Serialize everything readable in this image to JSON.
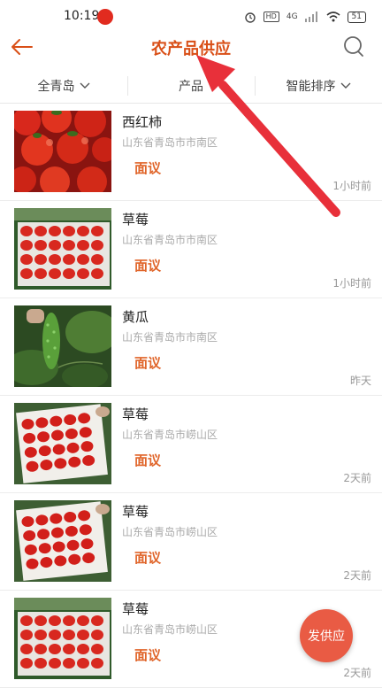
{
  "status_bar": {
    "time": "10:19",
    "hd": "HD",
    "network": "4G",
    "battery": "51"
  },
  "header": {
    "title": "农产品供应",
    "back_icon": "arrow-left-icon",
    "search_icon": "search-icon"
  },
  "filters": [
    {
      "label": "全青岛",
      "has_dropdown": true
    },
    {
      "label": "产品",
      "has_dropdown": false
    },
    {
      "label": "智能排序",
      "has_dropdown": true
    }
  ],
  "items": [
    {
      "name": "西红柿",
      "location": "山东省青岛市市南区",
      "price": "面议",
      "time": "1小时前",
      "image": "tomatoes"
    },
    {
      "name": "草莓",
      "location": "山东省青岛市市南区",
      "price": "面议",
      "time": "1小时前",
      "image": "strawberries"
    },
    {
      "name": "黄瓜",
      "location": "山东省青岛市市南区",
      "price": "面议",
      "time": "昨天",
      "image": "cucumber"
    },
    {
      "name": "草莓",
      "location": "山东省青岛市崂山区",
      "price": "面议",
      "time": "2天前",
      "image": "strawberry-box"
    },
    {
      "name": "草莓",
      "location": "山东省青岛市崂山区",
      "price": "面议",
      "time": "2天前",
      "image": "strawberry-box"
    },
    {
      "name": "草莓",
      "location": "山东省青岛市崂山区",
      "price": "面议",
      "time": "2天前",
      "image": "strawberries"
    }
  ],
  "fab": {
    "label": "发供应"
  },
  "colors": {
    "accent": "#d94f17",
    "price": "#e0652a",
    "fab": "#e95b44",
    "annotation_arrow": "#e8303a"
  }
}
